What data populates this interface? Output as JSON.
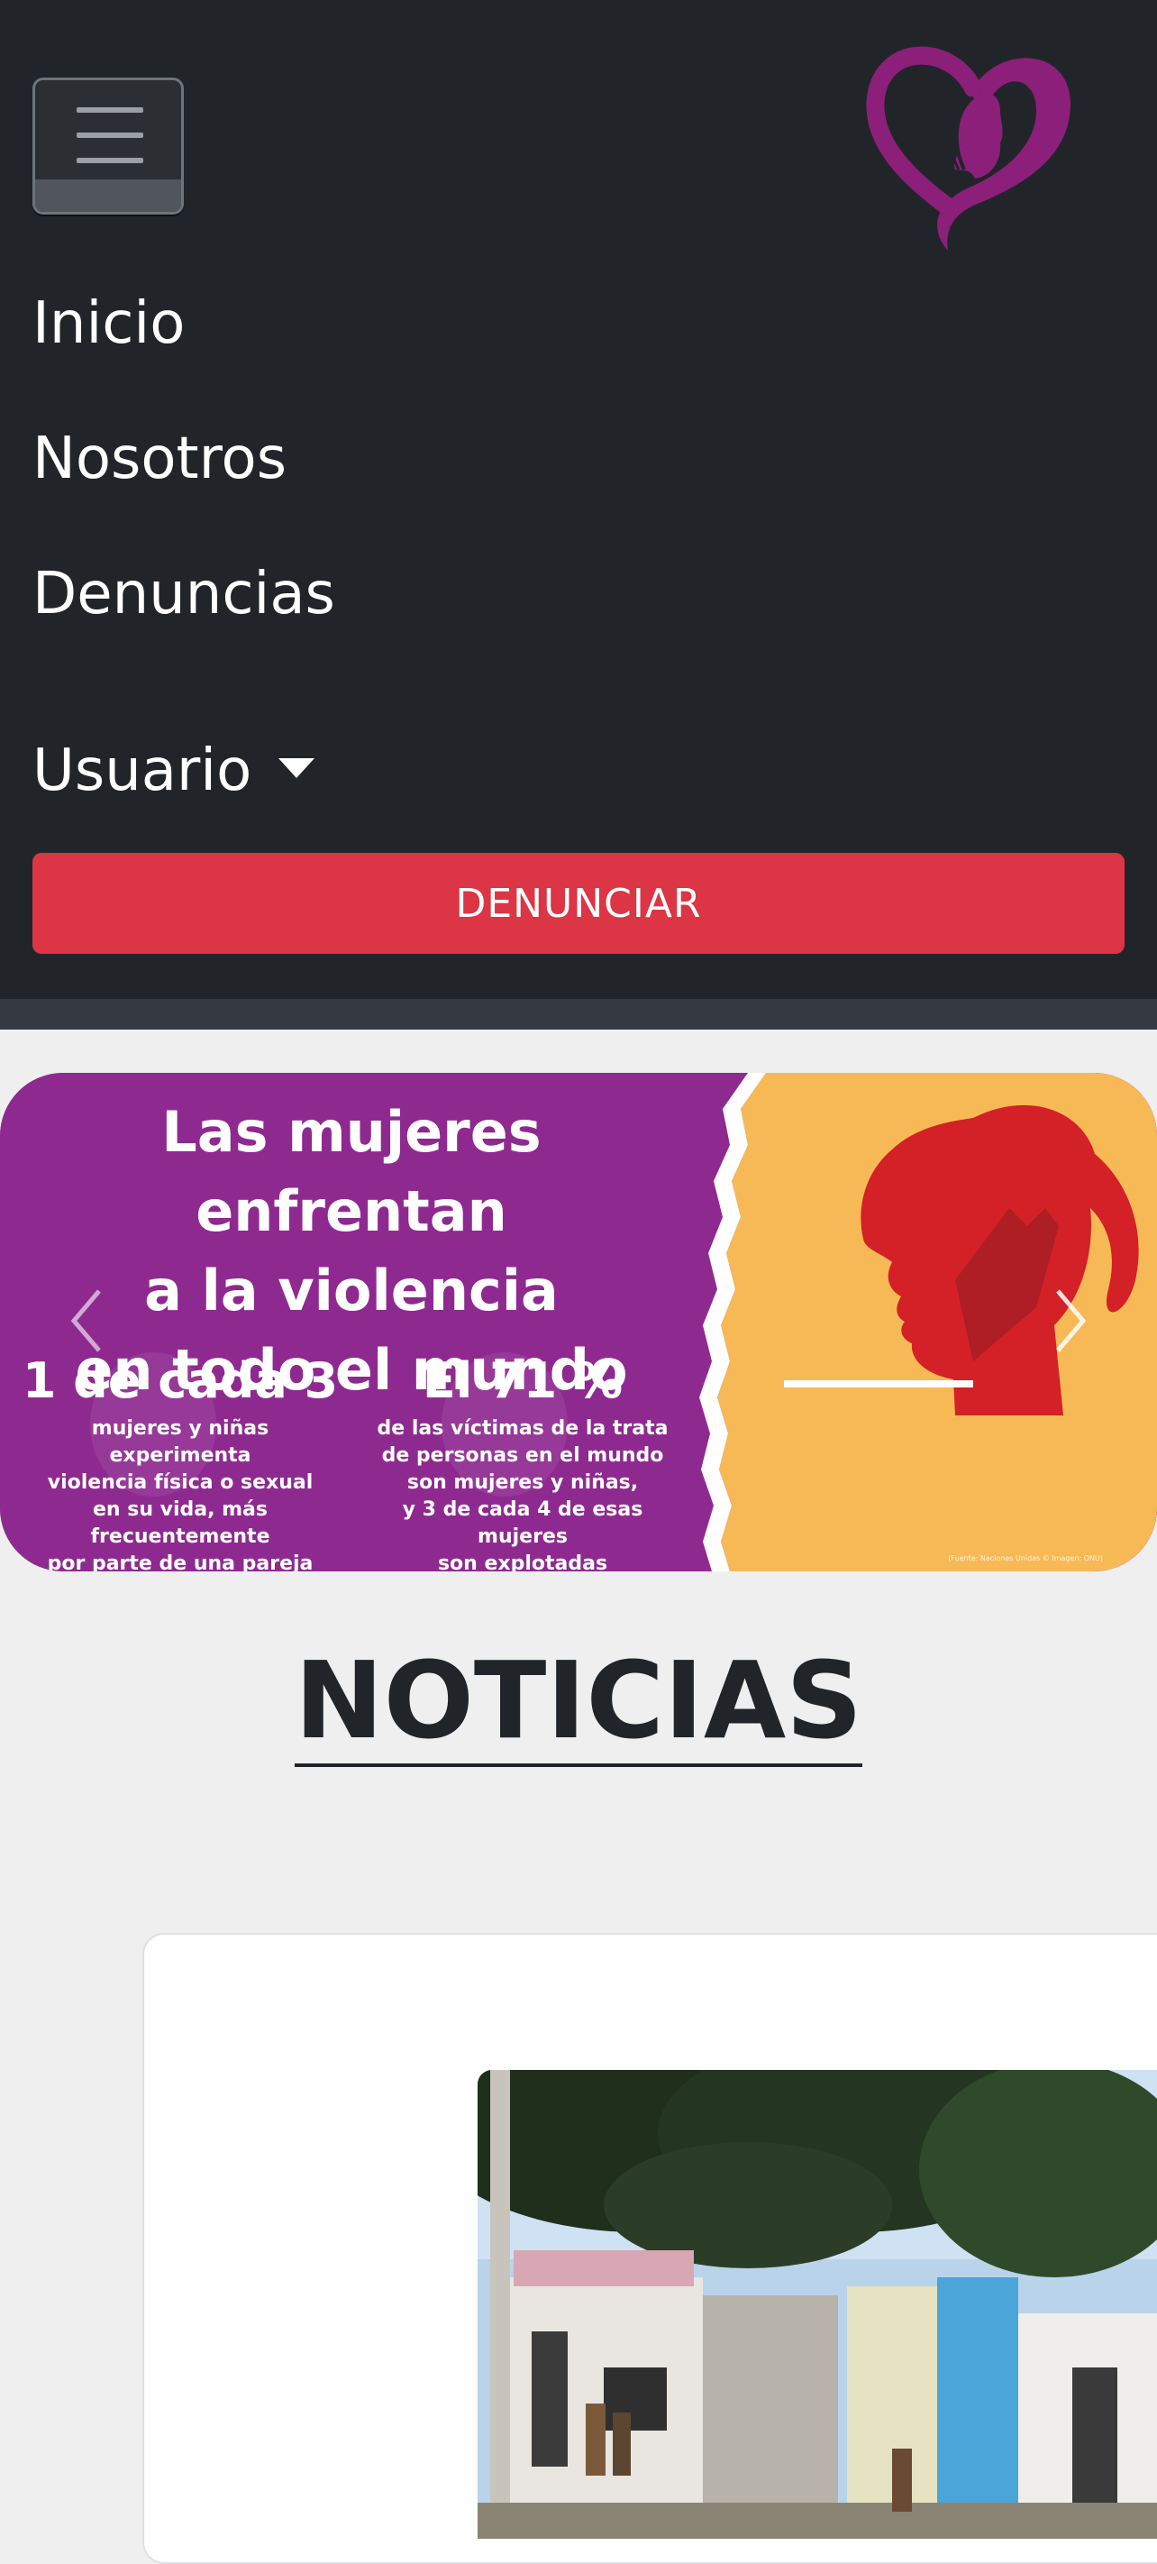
{
  "nav": {
    "toggler_icon": "hamburger-icon",
    "logo_icon": "heart-woman-logo-icon",
    "items": [
      {
        "label": "Inicio"
      },
      {
        "label": "Nosotros"
      },
      {
        "label": "Denuncias"
      }
    ],
    "user_menu": {
      "label": "Usuario",
      "icon": "caret-down-icon"
    },
    "cta_label": "DENUNCIAR"
  },
  "banner": {
    "headline_lines": [
      "Las mujeres enfrentan",
      "a la violencia",
      "en todo el mundo"
    ],
    "stat1_value": "1 de cada 3",
    "stat1_lines": [
      "mujeres y niñas experimenta",
      "violencia física o sexual",
      "en su vida, más frecuentemente",
      "por parte de una pareja íntima."
    ],
    "stat2_value": "El 71 %",
    "stat2_lines": [
      "de las víctimas de la trata",
      "de personas en el mundo",
      "son mujeres y niñas,",
      "y 3 de cada 4 de esas mujeres",
      "son explotadas sexualmente."
    ],
    "credit": "(Fuente: Naciones Unidas © Imagen: ONU)",
    "prev_icon": "chevron-left-icon",
    "next_icon": "chevron-right-icon"
  },
  "section_title": "NOTICIAS",
  "colors": {
    "navbar_bg": "#212529",
    "cta_bg": "#dc3545",
    "banner_purple": "#8e2a8f",
    "banner_orange": "#f7b955",
    "logo_purple": "#8b1f7a"
  }
}
